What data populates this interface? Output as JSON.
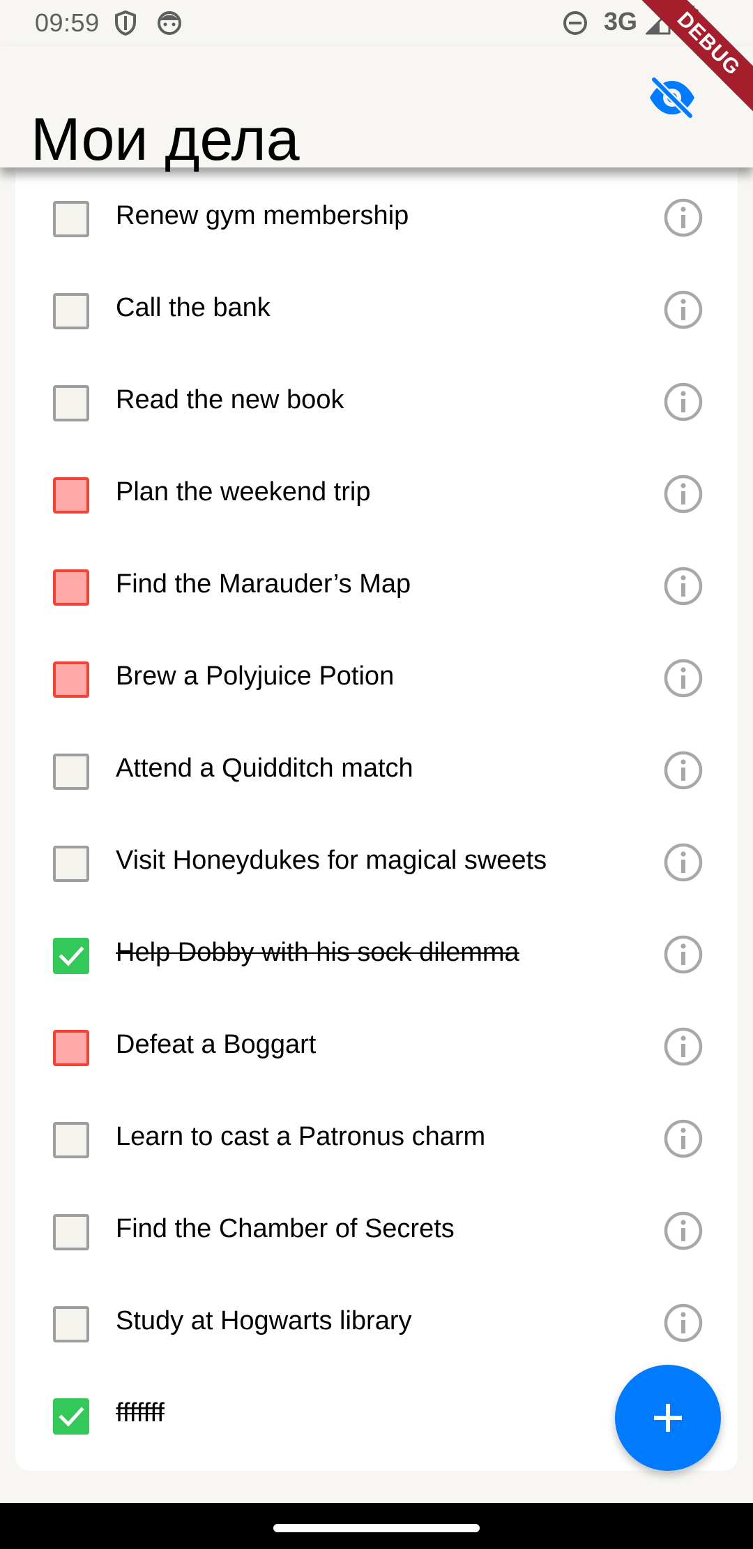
{
  "status_bar": {
    "time": "09:59",
    "network": "3G",
    "icons": [
      "shield-icon",
      "face-icon",
      "dnd-icon",
      "signal-icon",
      "battery-icon"
    ]
  },
  "app_bar": {
    "title": "Мои дела",
    "visibility_icon": "visibility-off-icon",
    "debug_label": "DEBUG"
  },
  "colors": {
    "accent": "#007AFF",
    "high_priority_border": "#F44336",
    "high_priority_fill": "#FFA8A8",
    "done": "#34C759",
    "unchecked_border": "#9E9E9E",
    "background": "#F7F6F2"
  },
  "tasks": [
    {
      "text": "Renew gym membership",
      "state": "unchecked"
    },
    {
      "text": "Call the bank",
      "state": "unchecked"
    },
    {
      "text": "Read the new book",
      "state": "unchecked"
    },
    {
      "text": "Plan the weekend trip",
      "state": "high"
    },
    {
      "text": "Find the Marauder’s Map",
      "state": "high"
    },
    {
      "text": "Brew a Polyjuice Potion",
      "state": "high"
    },
    {
      "text": "Attend a Quidditch match",
      "state": "unchecked"
    },
    {
      "text": "Visit Honeydukes for magical sweets",
      "state": "unchecked"
    },
    {
      "text": "Help Dobby with his sock dilemma",
      "state": "done"
    },
    {
      "text": "Defeat a Boggart",
      "state": "high"
    },
    {
      "text": "Learn to cast a Patronus charm",
      "state": "unchecked"
    },
    {
      "text": "Find the Chamber of Secrets",
      "state": "unchecked"
    },
    {
      "text": "Study at Hogwarts library",
      "state": "unchecked"
    },
    {
      "text": "fffffff",
      "state": "done"
    }
  ],
  "fab": {
    "icon": "plus-icon"
  }
}
